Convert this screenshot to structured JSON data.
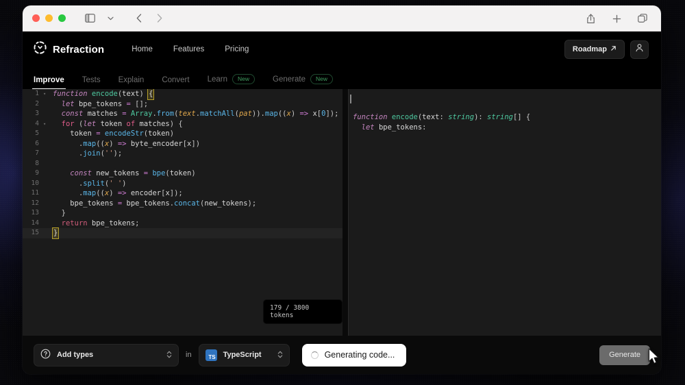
{
  "browser": {
    "traffic_lights": [
      "close",
      "minimize",
      "zoom"
    ],
    "sidebar_toggle_icon": "sidebar-icon",
    "dropdown_icon": "chevron-down-icon",
    "back_icon": "chevron-left-icon",
    "forward_icon": "chevron-right-icon",
    "share_icon": "share-icon",
    "new_tab_icon": "plus-icon",
    "tab_overview_icon": "tabs-icon"
  },
  "header": {
    "logo_icon": "refraction-logo-icon",
    "brand": "Refraction",
    "nav": [
      {
        "label": "Home"
      },
      {
        "label": "Features"
      },
      {
        "label": "Pricing"
      }
    ],
    "roadmap_label": "Roadmap",
    "roadmap_icon": "external-link-icon",
    "account_icon": "user-icon"
  },
  "tabs": [
    {
      "label": "Improve",
      "active": true,
      "badge": ""
    },
    {
      "label": "Tests",
      "active": false,
      "badge": ""
    },
    {
      "label": "Explain",
      "active": false,
      "badge": ""
    },
    {
      "label": "Convert",
      "active": false,
      "badge": ""
    },
    {
      "label": "Learn",
      "active": false,
      "badge": "New"
    },
    {
      "label": "Generate",
      "active": false,
      "badge": "New"
    }
  ],
  "editor": {
    "token_counter": "179 / 3800 tokens",
    "active_line": 15,
    "lines": [
      {
        "n": "1",
        "fold": true
      },
      {
        "n": "2",
        "fold": false
      },
      {
        "n": "3",
        "fold": false
      },
      {
        "n": "4",
        "fold": true
      },
      {
        "n": "5",
        "fold": false
      },
      {
        "n": "6",
        "fold": false
      },
      {
        "n": "7",
        "fold": false
      },
      {
        "n": "8",
        "fold": false
      },
      {
        "n": "9",
        "fold": false
      },
      {
        "n": "10",
        "fold": false
      },
      {
        "n": "11",
        "fold": false
      },
      {
        "n": "12",
        "fold": false
      },
      {
        "n": "13",
        "fold": false
      },
      {
        "n": "14",
        "fold": false
      },
      {
        "n": "15",
        "fold": false
      }
    ],
    "source_plain": [
      "function encode(text) {",
      "  let bpe_tokens = [];",
      "  const matches = Array.from(text.matchAll(pat)).map((x) => x[0]);",
      "  for (let token of matches) {",
      "    token = encodeStr(token)",
      "      .map((x) => byte_encoder[x])",
      "      .join('');",
      "",
      "    const new_tokens = bpe(token)",
      "      .split(' ')",
      "      .map((x) => encoder[x]);",
      "    bpe_tokens = bpe_tokens.concat(new_tokens);",
      "  }",
      "  return bpe_tokens;",
      "}"
    ]
  },
  "output": {
    "source_plain": [
      "function encode(text: string): string[] {",
      "  let bpe_tokens:"
    ]
  },
  "bottom": {
    "action_icon": "question-circle-icon",
    "action_label": "Add types",
    "in_word": "in",
    "language_icon": "typescript-icon",
    "language_logo_text": "TS",
    "language_label": "TypeScript",
    "status_icon": "spinner-icon",
    "status_label": "Generating code...",
    "generate_label": "Generate"
  },
  "colors": {
    "accent_green": "#3f9d5f",
    "typescript_blue": "#2f74c0",
    "editor_bg": "#1b1b1b",
    "app_bg": "#0a0a0a",
    "status_pill_bg": "#ffffff",
    "generate_btn_bg": "#6b6b6b"
  }
}
